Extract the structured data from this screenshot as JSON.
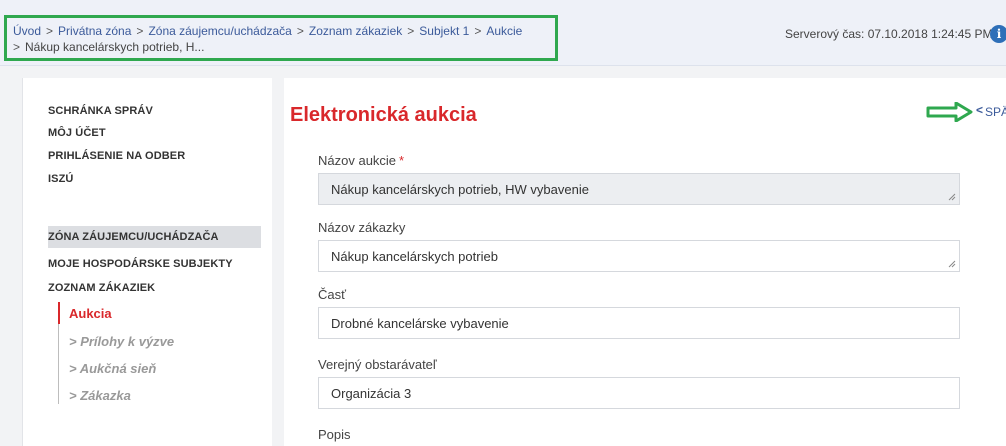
{
  "breadcrumb": {
    "items": [
      "Úvod",
      "Privátna zóna",
      "Zóna záujemcu/uchádzača",
      "Zoznam zákaziek",
      "Subjekt 1",
      "Aukcie",
      "Nákup kancelárskych potrieb, H..."
    ],
    "separator": ">"
  },
  "server_time": "Serverový čas: 07.10.2018 1:24:45 PM",
  "icons": {
    "info": "i"
  },
  "sidebar": {
    "top_items": [
      "SCHRÁNKA SPRÁV",
      "MÔJ ÚČET",
      "PRIHLÁSENIE NA ODBER",
      "ISZÚ"
    ],
    "zone_items": [
      "ZÓNA ZÁUJEMCU/UCHÁDZAČA",
      "MOJE HOSPODÁRSKE SUBJEKTY",
      "ZOZNAM ZÁKAZIEK"
    ],
    "sub_items": [
      "Aukcia",
      "> Prílohy k výzve",
      "> Aukčná sieň",
      "> Zákazka"
    ]
  },
  "main": {
    "title": "Elektronická aukcia",
    "back_chevron": "<",
    "back_label": "SPÄŤ",
    "fields": [
      {
        "label": "Názov aukcie",
        "required": "*",
        "value": "Nákup kancelárskych potrieb, HW vybavenie"
      },
      {
        "label": "Názov zákazky",
        "value": "Nákup kancelárskych potrieb"
      },
      {
        "label": "Časť",
        "value": "Drobné kancelárske vybavenie"
      },
      {
        "label": "Verejný obstarávateľ",
        "value": "Organizácia 3"
      },
      {
        "label": "Popis"
      }
    ]
  },
  "colors": {
    "accent_red": "#d9282b",
    "link_blue": "#3b5a9a",
    "highlight_green": "#2fa84f"
  }
}
